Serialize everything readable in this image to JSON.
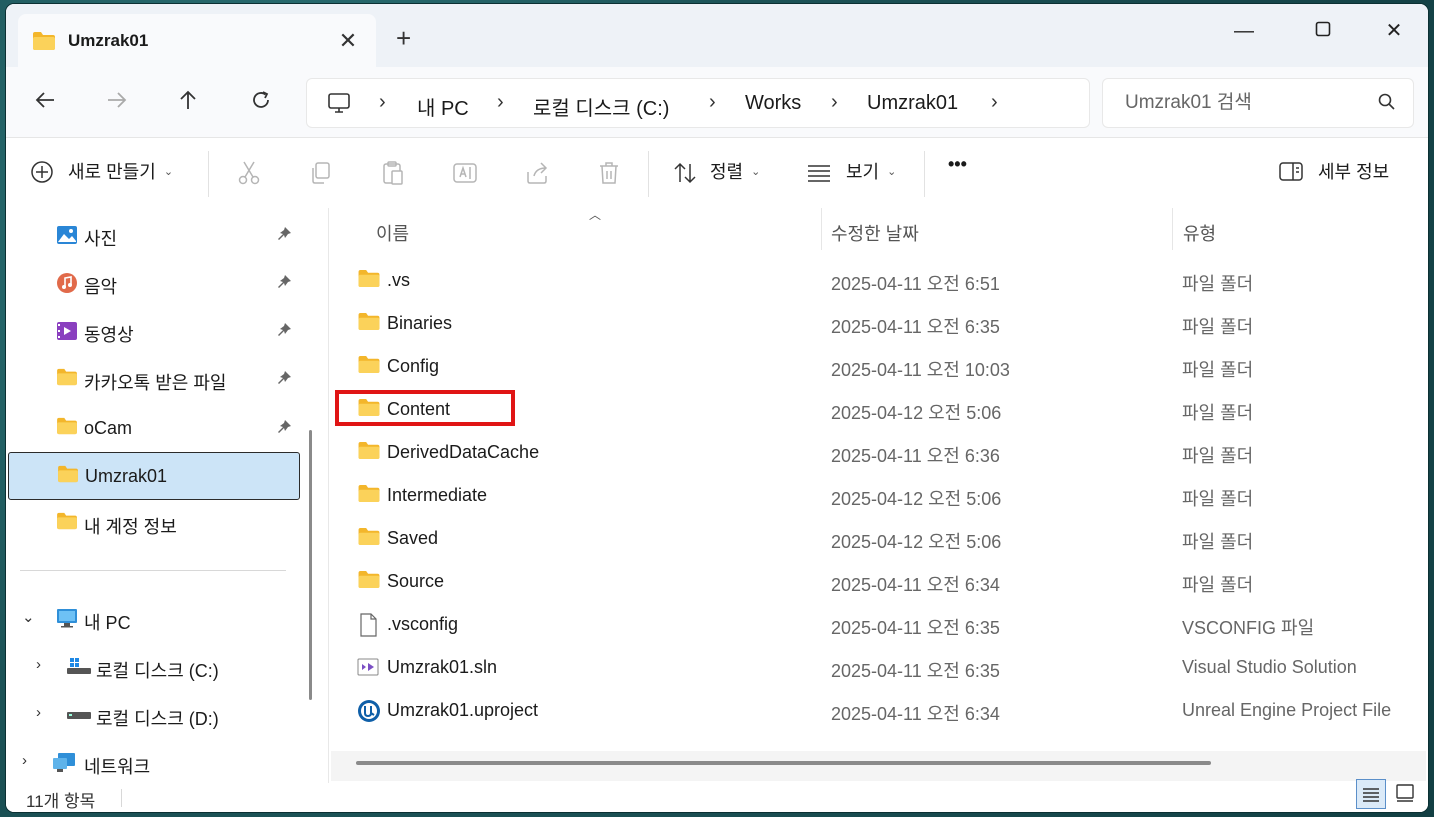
{
  "window": {
    "tab_title": "Umzrak01",
    "new_tab_label": "+",
    "controls": {
      "minimize": "—",
      "maximize": "☐",
      "close": "✕"
    }
  },
  "nav": {
    "breadcrumbs": [
      "내 PC",
      "로컬 디스크 (C:)",
      "Works",
      "Umzrak01"
    ],
    "search_placeholder": "Umzrak01 검색"
  },
  "toolbar": {
    "new_label": "새로 만들기",
    "sort_label": "정렬",
    "view_label": "보기",
    "more_label": "•••",
    "details_label": "세부 정보"
  },
  "sidebar": {
    "quick_items": [
      {
        "label": "사진",
        "icon": "photos-icon",
        "pinned": true
      },
      {
        "label": "음악",
        "icon": "music-icon",
        "pinned": true
      },
      {
        "label": "동영상",
        "icon": "videos-icon",
        "pinned": true
      },
      {
        "label": "카카오톡 받은 파일",
        "icon": "folder-icon",
        "pinned": true
      },
      {
        "label": "oCam",
        "icon": "folder-icon",
        "pinned": true
      },
      {
        "label": "Umzrak01",
        "icon": "folder-icon",
        "selected": true
      },
      {
        "label": "내 계정 정보",
        "icon": "folder-icon"
      }
    ],
    "this_pc": "내 PC",
    "drive_c": "로컬 디스크 (C:)",
    "drive_d": "로컬 디스크 (D:)",
    "network": "네트워크"
  },
  "columns": {
    "name": "이름",
    "date": "수정한 날짜",
    "type": "유형"
  },
  "files": [
    {
      "name": ".vs",
      "date": "2025-04-11 오전 6:51",
      "type": "파일 폴더",
      "icon": "folder-icon"
    },
    {
      "name": "Binaries",
      "date": "2025-04-11 오전 6:35",
      "type": "파일 폴더",
      "icon": "folder-icon"
    },
    {
      "name": "Config",
      "date": "2025-04-11 오전 10:03",
      "type": "파일 폴더",
      "icon": "folder-icon"
    },
    {
      "name": "Content",
      "date": "2025-04-12 오전 5:06",
      "type": "파일 폴더",
      "icon": "folder-icon",
      "highlighted": true
    },
    {
      "name": "DerivedDataCache",
      "date": "2025-04-11 오전 6:36",
      "type": "파일 폴더",
      "icon": "folder-icon"
    },
    {
      "name": "Intermediate",
      "date": "2025-04-12 오전 5:06",
      "type": "파일 폴더",
      "icon": "folder-icon"
    },
    {
      "name": "Saved",
      "date": "2025-04-12 오전 5:06",
      "type": "파일 폴더",
      "icon": "folder-icon"
    },
    {
      "name": "Source",
      "date": "2025-04-11 오전 6:34",
      "type": "파일 폴더",
      "icon": "folder-icon"
    },
    {
      "name": ".vsconfig",
      "date": "2025-04-11 오전 6:35",
      "type": "VSCONFIG 파일",
      "icon": "file-icon"
    },
    {
      "name": "Umzrak01.sln",
      "date": "2025-04-11 오전 6:35",
      "type": "Visual Studio Solution",
      "icon": "visual-studio-icon"
    },
    {
      "name": "Umzrak01.uproject",
      "date": "2025-04-11 오전 6:34",
      "type": "Unreal Engine Project File",
      "icon": "unreal-engine-icon"
    }
  ],
  "status": {
    "item_count": "11개 항목"
  },
  "colors": {
    "selection": "#cce4f7",
    "highlight_box": "#e01515",
    "folder": "#f7c948"
  }
}
